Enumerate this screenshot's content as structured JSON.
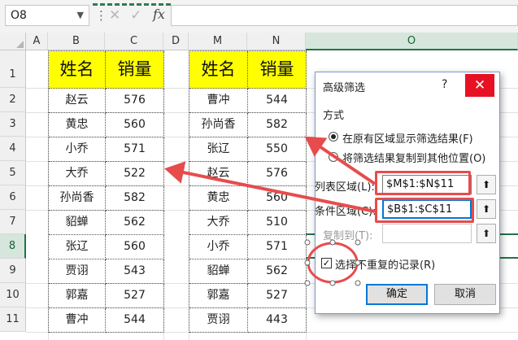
{
  "formula_bar": {
    "name_box": "O8",
    "fx_label": "fx",
    "formula": "",
    "icons": {
      "cancel": "close-icon",
      "enter": "check-icon"
    }
  },
  "columns": [
    "A",
    "B",
    "C",
    "D",
    "M",
    "N",
    "O"
  ],
  "rows": [
    "1",
    "2",
    "3",
    "4",
    "5",
    "6",
    "7",
    "8",
    "9",
    "10",
    "11"
  ],
  "table1": {
    "headers": [
      "姓名",
      "销量"
    ],
    "rows": [
      [
        "赵云",
        "576"
      ],
      [
        "黄忠",
        "560"
      ],
      [
        "小乔",
        "571"
      ],
      [
        "大乔",
        "522"
      ],
      [
        "孙尚香",
        "582"
      ],
      [
        "貂蝉",
        "562"
      ],
      [
        "张辽",
        "560"
      ],
      [
        "贾诩",
        "543"
      ],
      [
        "郭嘉",
        "527"
      ],
      [
        "曹冲",
        "544"
      ]
    ]
  },
  "table2": {
    "headers": [
      "姓名",
      "销量"
    ],
    "rows": [
      [
        "曹冲",
        "544"
      ],
      [
        "孙尚香",
        "582"
      ],
      [
        "张辽",
        "550"
      ],
      [
        "赵云",
        "576"
      ],
      [
        "黄忠",
        "560"
      ],
      [
        "大乔",
        "510"
      ],
      [
        "小乔",
        "571"
      ],
      [
        "貂蝉",
        "562"
      ],
      [
        "郭嘉",
        "527"
      ],
      [
        "贾诩",
        "443"
      ]
    ]
  },
  "dialog": {
    "title": "高级筛选",
    "help": "?",
    "close": "✕",
    "section_label": "方式",
    "option_inplace": "在原有区域显示筛选结果(F)",
    "option_copy": "将筛选结果复制到其他位置(O)",
    "list_range_label": "列表区域(L):",
    "list_range_value": "$M$1:$N$11",
    "criteria_range_label": "条件区域(C):",
    "criteria_range_value": "$B$1:$C$11",
    "copy_to_label": "复制到(T):",
    "copy_to_value": "",
    "unique_label": "选择不重复的记录(R)",
    "ok": "确定",
    "cancel": "取消",
    "colors": {
      "accent": "#0078d7",
      "close_bg": "#e81123",
      "annotation": "#e74c4c"
    }
  }
}
